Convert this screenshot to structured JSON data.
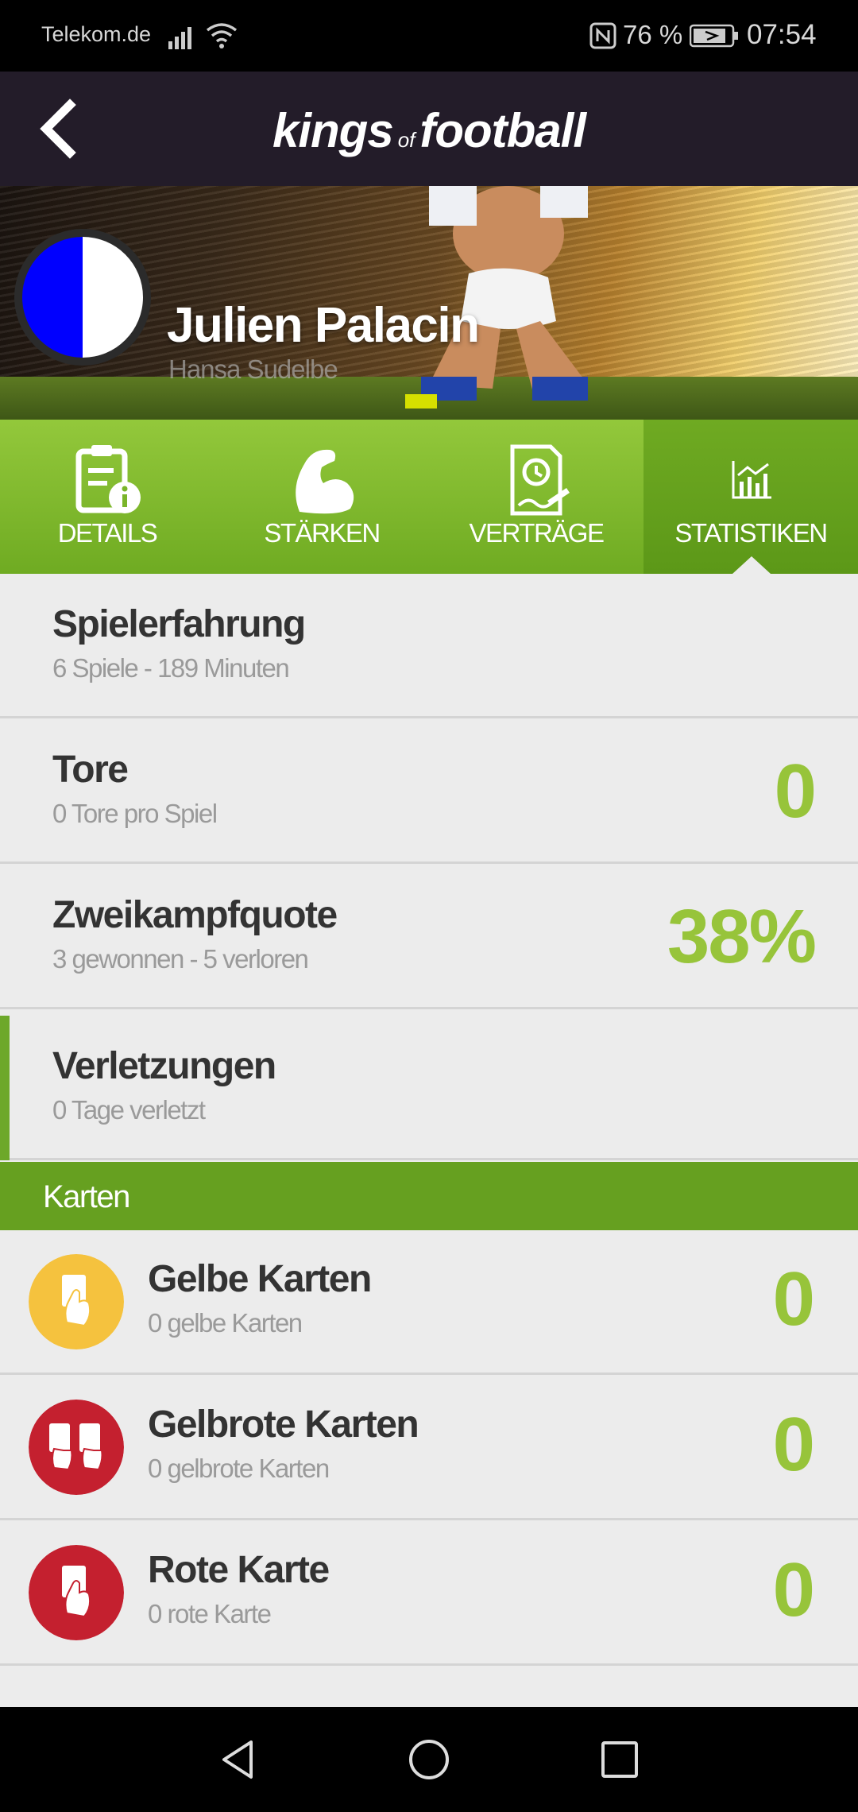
{
  "status_bar": {
    "carrier": "Telekom.de",
    "battery": "76 %",
    "time": "07:54",
    "icons": [
      "signal-icon",
      "wifi-icon",
      "nfc-icon",
      "battery-icon"
    ]
  },
  "app_bar": {
    "back_icon": "back-arrow-icon",
    "brand_part1": "kings",
    "brand_part2": "of",
    "brand_part3": "football"
  },
  "player": {
    "name": "Julien Palacin",
    "club": "Hansa Sudelbe",
    "badge_colors": [
      "#0000ff",
      "#ffffff"
    ]
  },
  "tabs": [
    {
      "label": "DETAILS",
      "icon": "details-icon",
      "active": false
    },
    {
      "label": "STÄRKEN",
      "icon": "muscle-icon",
      "active": false
    },
    {
      "label": "VERTRÄGE",
      "icon": "contract-icon",
      "active": false
    },
    {
      "label": "STATISTIKEN",
      "icon": "chart-icon",
      "active": true
    }
  ],
  "stats": [
    {
      "title": "Spielerfahrung",
      "subtitle": "6 Spiele - 189 Minuten",
      "value": ""
    },
    {
      "title": "Tore",
      "subtitle": "0 Tore pro Spiel",
      "value": "0"
    },
    {
      "title": "Zweikampfquote",
      "subtitle": "3 gewonnen - 5 verloren",
      "value": "38%"
    },
    {
      "title": "Verletzungen",
      "subtitle": "0 Tage verletzt",
      "value": ""
    }
  ],
  "cards_section": {
    "title": "Karten",
    "items": [
      {
        "title": "Gelbe Karten",
        "subtitle": "0 gelbe Karten",
        "value": "0",
        "icon": "yellow-card-icon",
        "color": "#f5c23e"
      },
      {
        "title": "Gelbrote Karten",
        "subtitle": "0 gelbrote Karten",
        "value": "0",
        "icon": "yellow-red-card-icon",
        "color": "#c4202f"
      },
      {
        "title": "Rote Karte",
        "subtitle": "0 rote Karte",
        "value": "0",
        "icon": "red-card-icon",
        "color": "#c4202f"
      }
    ]
  },
  "colors": {
    "accent_green": "#6fab22",
    "value_green": "#97c43a",
    "app_bar": "#231c29"
  },
  "nav_bar": {
    "icons": [
      "back-triangle-icon",
      "home-circle-icon",
      "recents-square-icon"
    ]
  }
}
